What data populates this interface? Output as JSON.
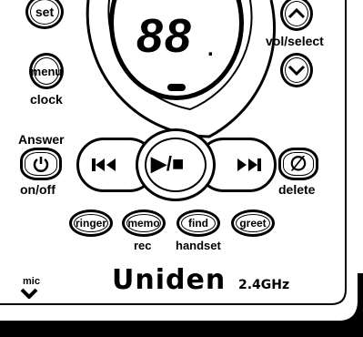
{
  "buttons": {
    "set": "set",
    "menu": "menu",
    "play_stop": "▶/■",
    "skip_back": "⏮",
    "skip_forward": "⏭",
    "power": "⏻",
    "delete_symbol": "∅",
    "ringer": "ringer",
    "memo": "memo",
    "find": "find",
    "greet": "greet"
  },
  "labels": {
    "clock": "clock",
    "vol_select": "vol/select",
    "answer": "Answer",
    "on_off": "on/off",
    "delete": "delete",
    "rec": "rec",
    "handset": "handset",
    "mic": "mic"
  },
  "display": {
    "digits": "88",
    "dot": "."
  },
  "brand": {
    "name": "Uniden",
    "band": "2.4GHz"
  }
}
